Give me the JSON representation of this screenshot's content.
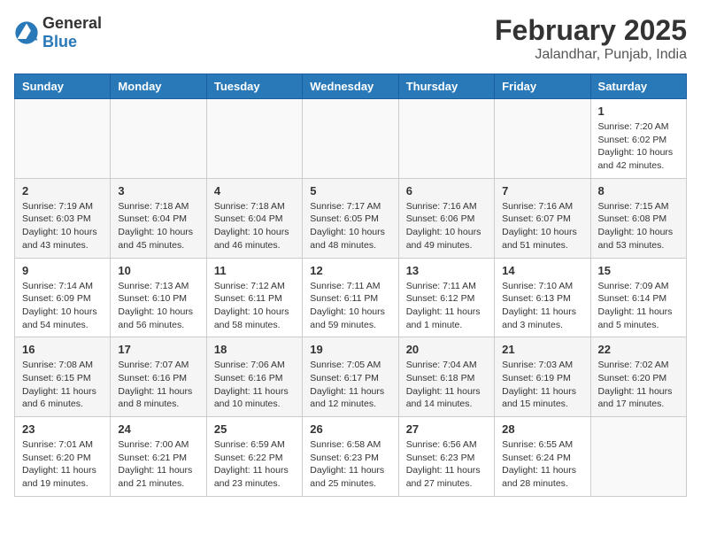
{
  "logo": {
    "general": "General",
    "blue": "Blue"
  },
  "title": "February 2025",
  "location": "Jalandhar, Punjab, India",
  "days_of_week": [
    "Sunday",
    "Monday",
    "Tuesday",
    "Wednesday",
    "Thursday",
    "Friday",
    "Saturday"
  ],
  "weeks": [
    [
      {
        "day": "",
        "info": ""
      },
      {
        "day": "",
        "info": ""
      },
      {
        "day": "",
        "info": ""
      },
      {
        "day": "",
        "info": ""
      },
      {
        "day": "",
        "info": ""
      },
      {
        "day": "",
        "info": ""
      },
      {
        "day": "1",
        "info": "Sunrise: 7:20 AM\nSunset: 6:02 PM\nDaylight: 10 hours and 42 minutes."
      }
    ],
    [
      {
        "day": "2",
        "info": "Sunrise: 7:19 AM\nSunset: 6:03 PM\nDaylight: 10 hours and 43 minutes."
      },
      {
        "day": "3",
        "info": "Sunrise: 7:18 AM\nSunset: 6:04 PM\nDaylight: 10 hours and 45 minutes."
      },
      {
        "day": "4",
        "info": "Sunrise: 7:18 AM\nSunset: 6:04 PM\nDaylight: 10 hours and 46 minutes."
      },
      {
        "day": "5",
        "info": "Sunrise: 7:17 AM\nSunset: 6:05 PM\nDaylight: 10 hours and 48 minutes."
      },
      {
        "day": "6",
        "info": "Sunrise: 7:16 AM\nSunset: 6:06 PM\nDaylight: 10 hours and 49 minutes."
      },
      {
        "day": "7",
        "info": "Sunrise: 7:16 AM\nSunset: 6:07 PM\nDaylight: 10 hours and 51 minutes."
      },
      {
        "day": "8",
        "info": "Sunrise: 7:15 AM\nSunset: 6:08 PM\nDaylight: 10 hours and 53 minutes."
      }
    ],
    [
      {
        "day": "9",
        "info": "Sunrise: 7:14 AM\nSunset: 6:09 PM\nDaylight: 10 hours and 54 minutes."
      },
      {
        "day": "10",
        "info": "Sunrise: 7:13 AM\nSunset: 6:10 PM\nDaylight: 10 hours and 56 minutes."
      },
      {
        "day": "11",
        "info": "Sunrise: 7:12 AM\nSunset: 6:11 PM\nDaylight: 10 hours and 58 minutes."
      },
      {
        "day": "12",
        "info": "Sunrise: 7:11 AM\nSunset: 6:11 PM\nDaylight: 10 hours and 59 minutes."
      },
      {
        "day": "13",
        "info": "Sunrise: 7:11 AM\nSunset: 6:12 PM\nDaylight: 11 hours and 1 minute."
      },
      {
        "day": "14",
        "info": "Sunrise: 7:10 AM\nSunset: 6:13 PM\nDaylight: 11 hours and 3 minutes."
      },
      {
        "day": "15",
        "info": "Sunrise: 7:09 AM\nSunset: 6:14 PM\nDaylight: 11 hours and 5 minutes."
      }
    ],
    [
      {
        "day": "16",
        "info": "Sunrise: 7:08 AM\nSunset: 6:15 PM\nDaylight: 11 hours and 6 minutes."
      },
      {
        "day": "17",
        "info": "Sunrise: 7:07 AM\nSunset: 6:16 PM\nDaylight: 11 hours and 8 minutes."
      },
      {
        "day": "18",
        "info": "Sunrise: 7:06 AM\nSunset: 6:16 PM\nDaylight: 11 hours and 10 minutes."
      },
      {
        "day": "19",
        "info": "Sunrise: 7:05 AM\nSunset: 6:17 PM\nDaylight: 11 hours and 12 minutes."
      },
      {
        "day": "20",
        "info": "Sunrise: 7:04 AM\nSunset: 6:18 PM\nDaylight: 11 hours and 14 minutes."
      },
      {
        "day": "21",
        "info": "Sunrise: 7:03 AM\nSunset: 6:19 PM\nDaylight: 11 hours and 15 minutes."
      },
      {
        "day": "22",
        "info": "Sunrise: 7:02 AM\nSunset: 6:20 PM\nDaylight: 11 hours and 17 minutes."
      }
    ],
    [
      {
        "day": "23",
        "info": "Sunrise: 7:01 AM\nSunset: 6:20 PM\nDaylight: 11 hours and 19 minutes."
      },
      {
        "day": "24",
        "info": "Sunrise: 7:00 AM\nSunset: 6:21 PM\nDaylight: 11 hours and 21 minutes."
      },
      {
        "day": "25",
        "info": "Sunrise: 6:59 AM\nSunset: 6:22 PM\nDaylight: 11 hours and 23 minutes."
      },
      {
        "day": "26",
        "info": "Sunrise: 6:58 AM\nSunset: 6:23 PM\nDaylight: 11 hours and 25 minutes."
      },
      {
        "day": "27",
        "info": "Sunrise: 6:56 AM\nSunset: 6:23 PM\nDaylight: 11 hours and 27 minutes."
      },
      {
        "day": "28",
        "info": "Sunrise: 6:55 AM\nSunset: 6:24 PM\nDaylight: 11 hours and 28 minutes."
      },
      {
        "day": "",
        "info": ""
      }
    ]
  ]
}
